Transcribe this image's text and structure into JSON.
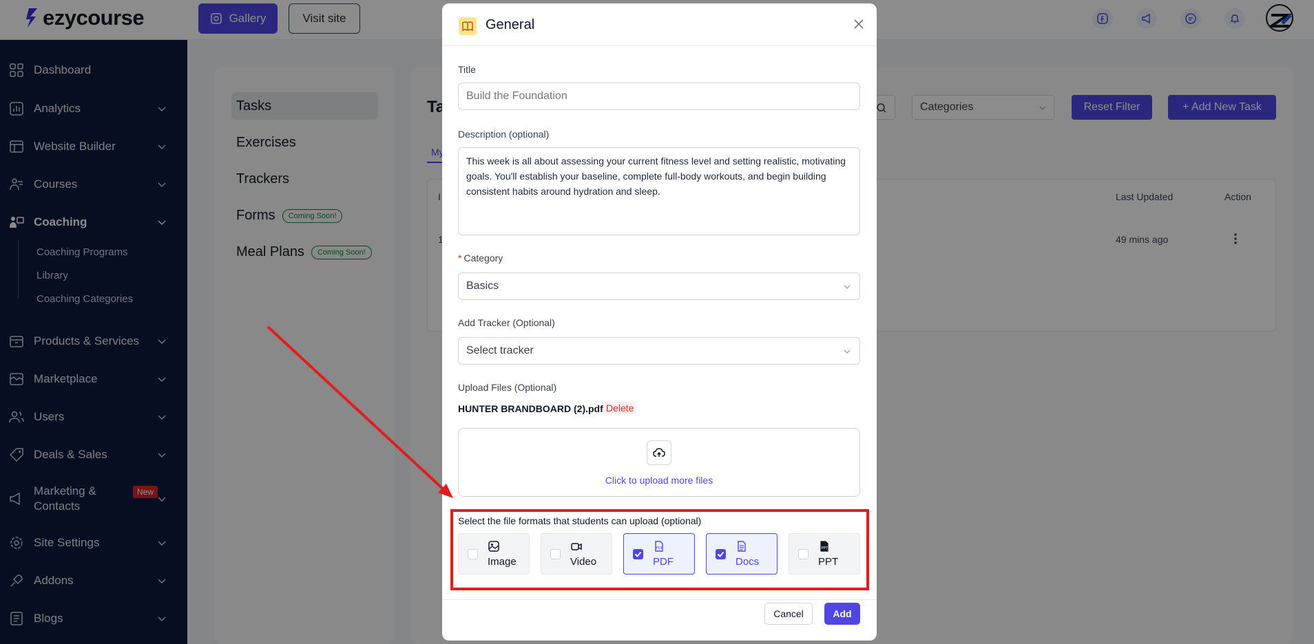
{
  "brand": {
    "name": "ezycourse"
  },
  "topbar": {
    "gallery_label": "Gallery",
    "visit_label": "Visit site"
  },
  "sidebar": {
    "items": [
      {
        "label": "Dashboard",
        "icon": "dashboard-icon"
      },
      {
        "label": "Analytics",
        "icon": "analytics-icon"
      },
      {
        "label": "Website Builder",
        "icon": "website-icon"
      },
      {
        "label": "Courses",
        "icon": "courses-icon"
      },
      {
        "label": "Coaching",
        "icon": "coaching-icon"
      },
      {
        "label": "Products & Services",
        "icon": "products-icon"
      },
      {
        "label": "Marketplace",
        "icon": "marketplace-icon"
      },
      {
        "label": "Users",
        "icon": "users-icon"
      },
      {
        "label": "Deals & Sales",
        "icon": "deals-icon"
      },
      {
        "label": "Marketing &",
        "label2": "Contacts",
        "icon": "marketing-icon",
        "badge": "New"
      },
      {
        "label": "Site Settings",
        "icon": "settings-icon"
      },
      {
        "label": "Addons",
        "icon": "addons-icon"
      },
      {
        "label": "Blogs",
        "icon": "blogs-icon"
      }
    ],
    "coaching_sub": [
      "Coaching Programs",
      "Library",
      "Coaching Categories"
    ]
  },
  "left_nav": {
    "items": [
      "Tasks",
      "Exercises",
      "Trackers",
      "Forms",
      "Meal Plans"
    ],
    "coming_soon": "Coming Soon!"
  },
  "tasks_panel": {
    "title_partial": "Ta",
    "tab_partial": "My",
    "categories_placeholder": "Categories",
    "reset_label": "Reset Filter",
    "add_label": "+ Add New Task",
    "columns": {
      "last_updated": "Last Updated",
      "action": "Action"
    },
    "row": {
      "id_partial": "1",
      "last_updated": "49 mins ago"
    },
    "header_partial": "I"
  },
  "modal": {
    "title": "General",
    "title_label": "Title",
    "title_placeholder": "Build the Foundation",
    "description_label": "Description (optional)",
    "description_value": "This week is all about assessing your current fitness level and setting realistic, motivating goals. You'll establish your baseline, complete full-body workouts, and begin building consistent habits around hydration and sleep.",
    "category_label": "Category",
    "category_required": "*",
    "category_value": "Basics",
    "tracker_label": "Add Tracker (Optional)",
    "tracker_placeholder": "Select tracker",
    "upload_label": "Upload Files (Optional)",
    "file_name": "HUNTER BRANDBOARD (2).pdf",
    "delete_label": "Delete",
    "upload_more": "Click to upload more files",
    "formats_label": "Select the file formats that students can upload (optional)",
    "formats": [
      {
        "name": "Image",
        "checked": false,
        "icon": "image-icon"
      },
      {
        "name": "Video",
        "checked": false,
        "icon": "video-icon"
      },
      {
        "name": "PDF",
        "checked": true,
        "icon": "pdf-icon"
      },
      {
        "name": "Docs",
        "checked": true,
        "icon": "docs-icon"
      },
      {
        "name": "PPT",
        "checked": false,
        "icon": "ppt-icon"
      }
    ],
    "cancel_label": "Cancel",
    "add_label": "Add"
  },
  "colors": {
    "accent": "#4f46e5",
    "sidebar": "#0f1b3d",
    "highlight": "#e11d1d"
  }
}
